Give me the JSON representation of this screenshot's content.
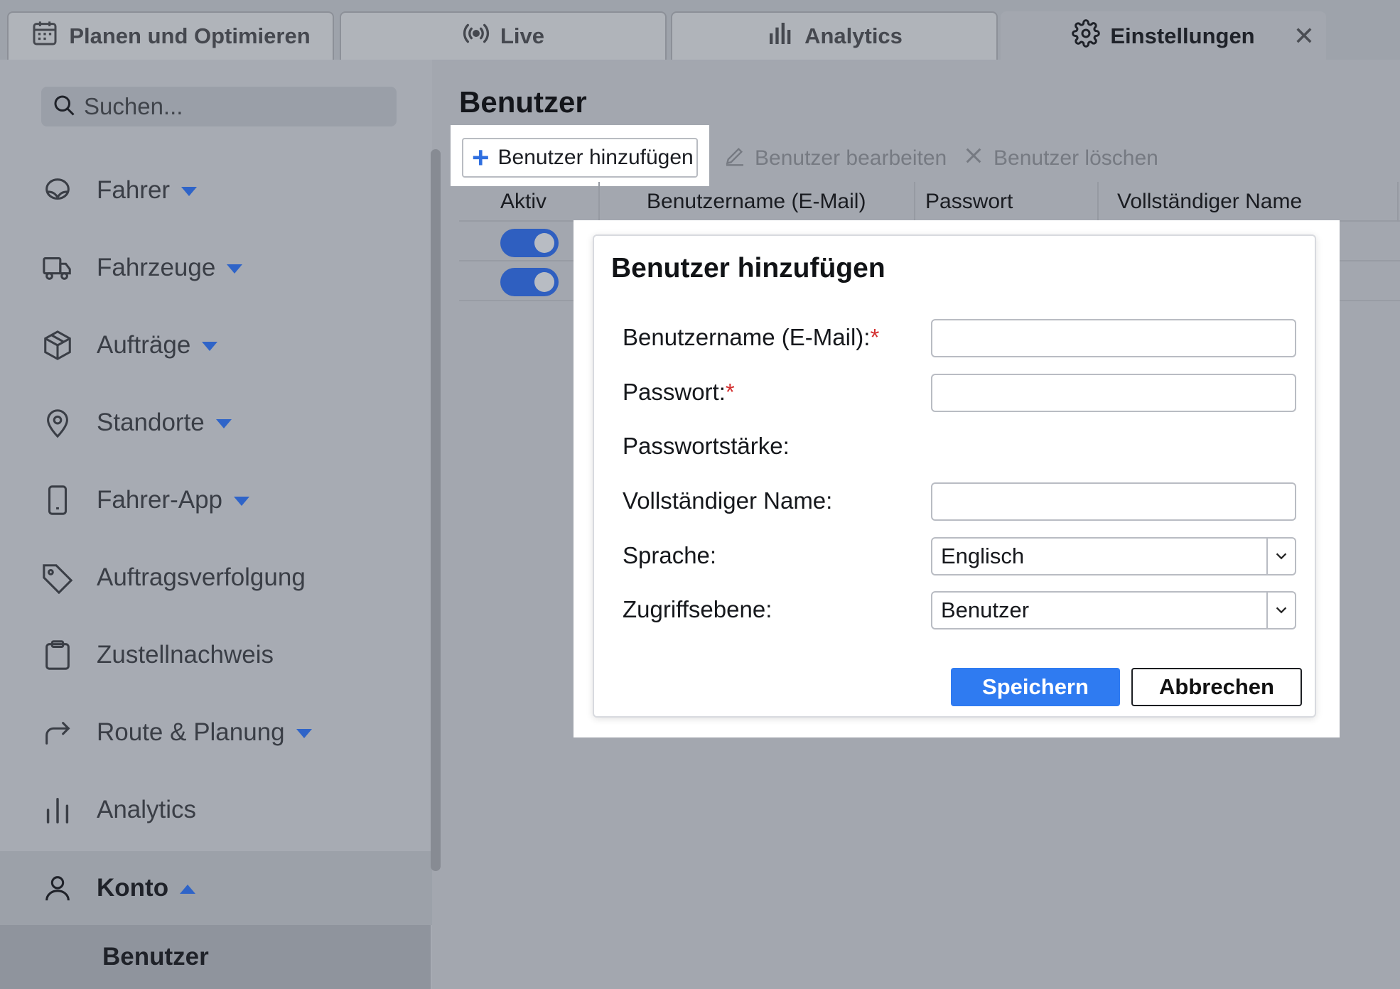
{
  "tabs": [
    {
      "label": "Planen und Optimieren",
      "icon": "calendar-icon"
    },
    {
      "label": "Live",
      "icon": "broadcast-icon"
    },
    {
      "label": "Analytics",
      "icon": "bar-chart-icon"
    },
    {
      "label": "Einstellungen",
      "icon": "gear-icon",
      "active": true
    }
  ],
  "tab_close": "✕",
  "sidebar": {
    "search_placeholder": "Suchen...",
    "items": [
      {
        "label": "Fahrer",
        "icon": "steering-wheel-icon",
        "expandable": true
      },
      {
        "label": "Fahrzeuge",
        "icon": "truck-icon",
        "expandable": true
      },
      {
        "label": "Aufträge",
        "icon": "package-icon",
        "expandable": true
      },
      {
        "label": "Standorte",
        "icon": "map-pin-icon",
        "expandable": true
      },
      {
        "label": "Fahrer-App",
        "icon": "phone-icon",
        "expandable": true
      },
      {
        "label": "Auftragsverfolgung",
        "icon": "tag-icon",
        "expandable": false
      },
      {
        "label": "Zustellnachweis",
        "icon": "clipboard-icon",
        "expandable": false
      },
      {
        "label": "Route & Planung",
        "icon": "route-arrow-icon",
        "expandable": true
      },
      {
        "label": "Analytics",
        "icon": "analytics-icon",
        "expandable": false
      },
      {
        "label": "Konto",
        "icon": "user-icon",
        "expanded": true
      }
    ],
    "subitem": "Benutzer"
  },
  "main": {
    "title": "Benutzer",
    "toolbar": {
      "add_label": "Benutzer hinzufügen",
      "edit_label": "Benutzer bearbeiten",
      "delete_label": "Benutzer löschen"
    },
    "columns": [
      "Aktiv",
      "Benutzername (E-Mail)",
      "Passwort",
      "Vollständiger Name"
    ],
    "rows": [
      {
        "active": true
      },
      {
        "active": true
      }
    ]
  },
  "dialog": {
    "title": "Benutzer hinzufügen",
    "fields": {
      "username_label": "Benutzername (E-Mail):",
      "password_label": "Passwort:",
      "strength_label": "Passwortstärke:",
      "fullname_label": "Vollständiger Name:",
      "language_label": "Sprache:",
      "language_value": "Englisch",
      "access_label": "Zugriffsebene:",
      "access_value": "Benutzer",
      "required_mark": "*"
    },
    "save_label": "Speichern",
    "cancel_label": "Abbrechen"
  },
  "colors": {
    "accent": "#2f7bf1",
    "toggle": "#2f5fc0",
    "required": "#d32f2f",
    "overlay_background": "#a3a7af"
  }
}
